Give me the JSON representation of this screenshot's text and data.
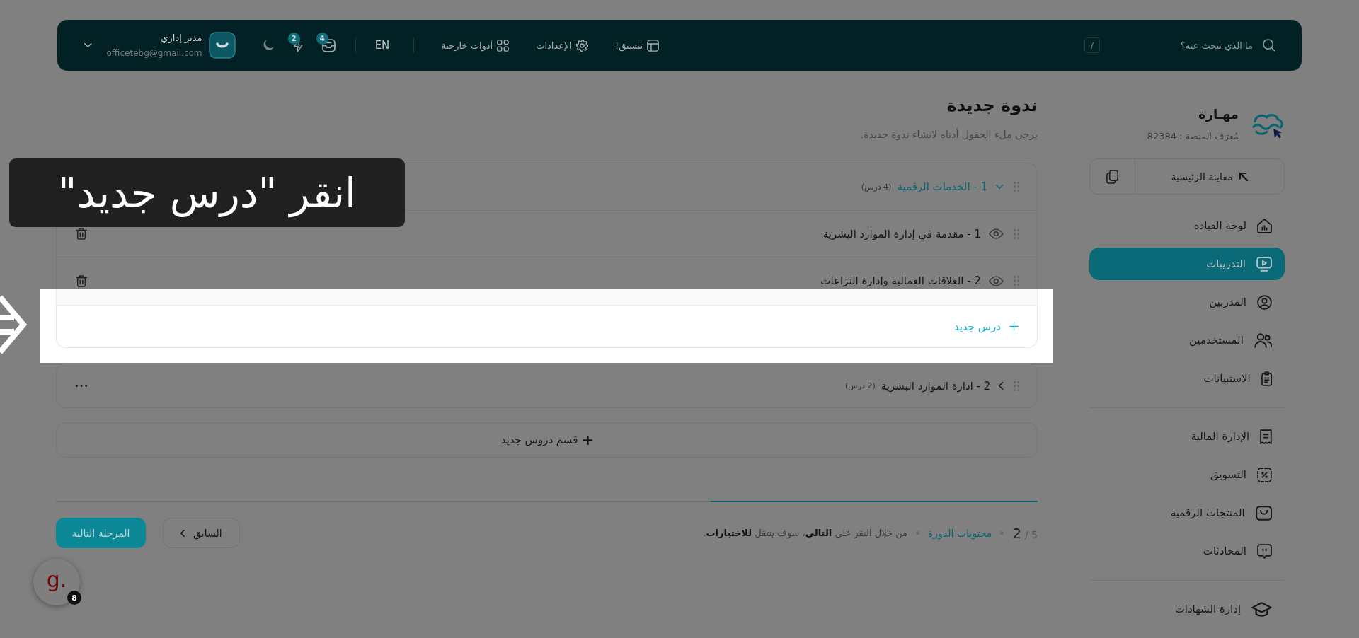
{
  "top_bar": {
    "search": {
      "placeholder": "ما الذي تبحث عنه؟",
      "shortcut": "/"
    },
    "links": [
      "تنسيق!",
      "الإعدادات",
      "أدوات خارجية"
    ],
    "language": "EN",
    "notifications": [
      {
        "count": "4"
      },
      {
        "count": "2"
      }
    ],
    "user": {
      "name": "مدير إداري",
      "email": "officetebg@gmail.com"
    }
  },
  "sidebar": {
    "brand": "مهـارة",
    "platform_id": "مُعرَف المنصة : 82384",
    "preview_button": "معاينة الرئيسية",
    "groups": [
      {
        "items": [
          {
            "label": "لوحة القيادة",
            "selected": false
          },
          {
            "label": "التدريبات",
            "selected": true
          },
          {
            "label": "المدربين",
            "selected": false
          },
          {
            "label": "المستخدمين",
            "selected": false
          },
          {
            "label": "الاستبيانات",
            "selected": false
          }
        ]
      },
      {
        "items": [
          {
            "label": "الإدارة المالية",
            "selected": false
          },
          {
            "label": "التسويق",
            "selected": false
          },
          {
            "label": "المنتجات الرقمية",
            "selected": false
          },
          {
            "label": "المحادثات",
            "selected": false
          }
        ]
      },
      {
        "items": [
          {
            "label": "إدارة الشهادات",
            "selected": false
          }
        ]
      }
    ]
  },
  "page": {
    "title": "ندوة جديدة",
    "subtitle": "يرجى ملء الحقول أدناه لانشاء ندوة جديدة."
  },
  "sections": [
    {
      "title": "1 - الخدمات الرقمية",
      "count": "(4 درس)",
      "expanded": true,
      "lessons": [
        "1 - مقدمة في إدارة الموارد البشرية",
        "2 - العلاقات العمالية وإدارة النزاعات"
      ],
      "new_lesson": "درس جديد"
    },
    {
      "title": "2 - ادارة الموارد البشرية",
      "count": "(2 درس)",
      "expanded": false
    }
  ],
  "new_section_button": "قسم دروس جديد",
  "progress": {
    "level": 0.333
  },
  "footer": {
    "step_current": "2",
    "step_total": "/ 5",
    "link": "محتويات الدورة",
    "note": "من خلال النقر على **التالي**، سوف ينتقل **للاختبارات**.",
    "prev_button": "السابق",
    "next_button": "المرحلة التالية"
  },
  "help_widget": {
    "letter": "g.",
    "badge": "8"
  },
  "tutorial": {
    "caption": "انقر \"درس جديد\""
  }
}
